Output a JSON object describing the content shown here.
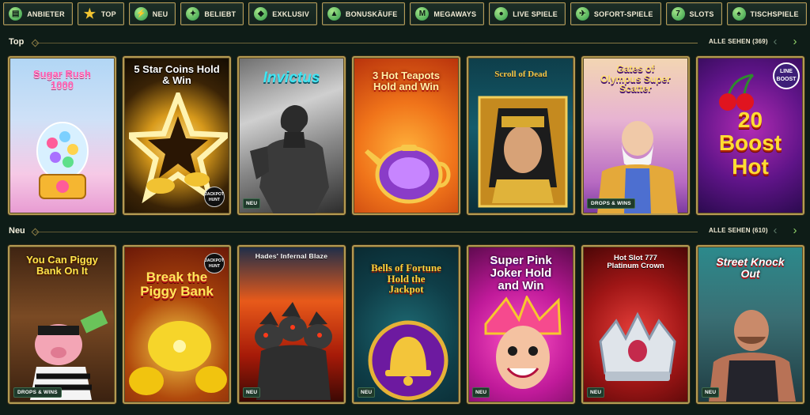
{
  "nav": [
    {
      "label": "ANBIETER",
      "icon": "provider-icon",
      "glyph": "▤"
    },
    {
      "label": "TOP",
      "icon": "star-icon",
      "glyph": "★"
    },
    {
      "label": "NEU",
      "icon": "new-icon",
      "glyph": "⚡"
    },
    {
      "label": "BELIEBT",
      "icon": "popular-icon",
      "glyph": "✦"
    },
    {
      "label": "EXKLUSIV",
      "icon": "diamond-icon",
      "glyph": "◆"
    },
    {
      "label": "BONUSKÄUFE",
      "icon": "bonus-buy-icon",
      "glyph": "▲"
    },
    {
      "label": "MEGAWAYS",
      "icon": "megaways-icon",
      "glyph": "M"
    },
    {
      "label": "LIVE SPIELE",
      "icon": "live-games-icon",
      "glyph": "●"
    },
    {
      "label": "SOFORT-SPIELE",
      "icon": "instant-games-icon",
      "glyph": "✈"
    },
    {
      "label": "SLOTS",
      "icon": "slots-icon",
      "glyph": "7"
    },
    {
      "label": "TISCHSPIELE",
      "icon": "table-games-icon",
      "glyph": "♠"
    }
  ],
  "sections": [
    {
      "title": "Top",
      "see_all": "ALLE SEHEN (369)",
      "games": [
        {
          "title": "Sugar Rush 1000",
          "theme": "sugar"
        },
        {
          "title": "5 Star Coins Hold & Win",
          "theme": "star",
          "corner": "JACKPOT HUNT"
        },
        {
          "title": "Invictus",
          "theme": "invictus",
          "badge": "NEU"
        },
        {
          "title": "3 Hot Teapots Hold and Win",
          "theme": "teapot"
        },
        {
          "title": "Scroll of Dead",
          "theme": "scroll"
        },
        {
          "title": "Gates of Olympus Super Scatter",
          "theme": "olympus",
          "badge": "DROPS & WINS"
        },
        {
          "title": "20 Boost Hot",
          "theme": "boost",
          "corner": "LINE BOOST"
        }
      ]
    },
    {
      "title": "Neu",
      "see_all": "ALLE SEHEN (610)",
      "games": [
        {
          "title": "You Can Piggy Bank On It",
          "theme": "piggy",
          "badge": "DROPS & WINS"
        },
        {
          "title": "Break the Piggy Bank",
          "theme": "break",
          "corner": "JACKPOT HUNT"
        },
        {
          "title": "Hades' Infernal Blaze",
          "theme": "hades",
          "badge": "NEU"
        },
        {
          "title": "Bells of Fortune Hold the Jackpot",
          "theme": "bells",
          "badge": "NEU"
        },
        {
          "title": "Super Pink Joker Hold and Win",
          "theme": "joker",
          "badge": "NEU"
        },
        {
          "title": "Hot Slot 777 Platinum Crown",
          "theme": "crown",
          "badge": "NEU"
        },
        {
          "title": "Street Knock Out",
          "theme": "street",
          "badge": "NEU"
        }
      ]
    }
  ],
  "colors": {
    "accent": "#8fd16a",
    "border": "#b49a52",
    "background": "#0e1c17"
  }
}
